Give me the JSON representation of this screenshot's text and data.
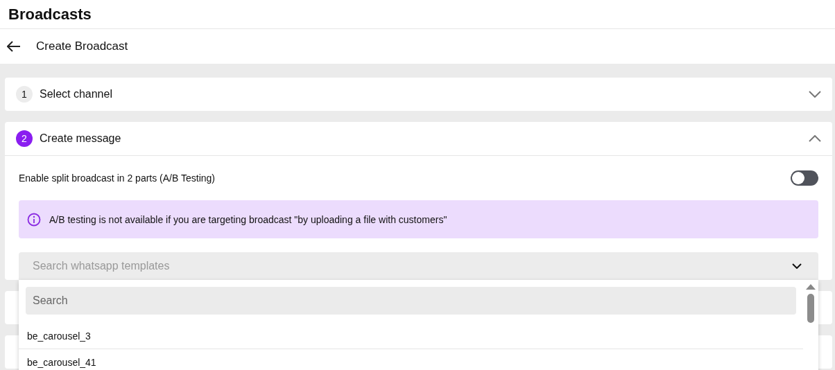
{
  "page_title": "Broadcasts",
  "header": {
    "title": "Create Broadcast"
  },
  "steps": [
    {
      "number": "1",
      "title": "Select channel",
      "selected": false,
      "expanded": false
    },
    {
      "number": "2",
      "title": "Create message",
      "selected": true,
      "expanded": true
    }
  ],
  "split_toggle": {
    "label": "Enable split broadcast in 2 parts (A/B Testing)",
    "on": false
  },
  "notice": "A/B testing is not available if you are targeting broadcast \"by uploading a file with customers\"",
  "template_select": {
    "placeholder": "Search whatsapp templates",
    "expanded": true
  },
  "dropdown": {
    "search_placeholder": "Search",
    "items": [
      {
        "label": "be_carousel_3"
      },
      {
        "label": "be_carousel_41"
      }
    ]
  }
}
